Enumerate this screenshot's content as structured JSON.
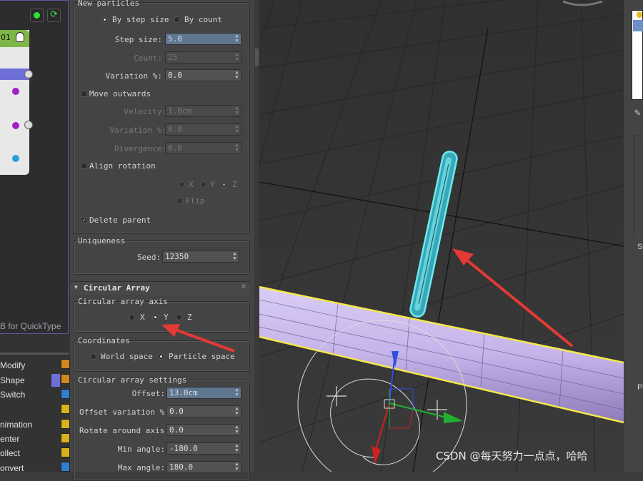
{
  "node_editor": {
    "node_title": "01",
    "quicktype_hint": "B for QuickType",
    "operators": [
      "Modify",
      "Shape",
      "Switch",
      "nimation",
      "enter",
      "ollect",
      "onvert"
    ]
  },
  "new_particles": {
    "title": "New particles",
    "by_step_size": "By step size",
    "by_count": "By count",
    "step_size_label": "Step size:",
    "step_size_value": "5.0",
    "count_label": "Count:",
    "count_value": "25",
    "variation_label": "Variation %:",
    "variation_value": "0.0",
    "move_outwards": "Move outwards",
    "velocity_label": "Velocity:",
    "velocity_value": "1.0cm",
    "variation2_label": "Variation %:",
    "variation2_value": "0.0",
    "divergence_label": "Divergence:",
    "divergence_value": "0.0",
    "align_rotation": "Align rotation",
    "axis_x": "X",
    "axis_y": "Y",
    "axis_z": "Z",
    "flip": "Flip",
    "delete_parent": "Delete parent"
  },
  "uniqueness": {
    "title": "Uniqueness",
    "seed_label": "Seed:",
    "seed_value": "12350"
  },
  "circular_array": {
    "rollout_title": "Circular Array",
    "axis_group": "Circular array axis",
    "axis_x": "X",
    "axis_y": "Y",
    "axis_z": "Z",
    "selected_axis": "Y",
    "coords_group": "Coordinates",
    "world_space": "World space",
    "particle_space": "Particle space",
    "settings_group": "Circular array settings",
    "offset_label": "Offset:",
    "offset_value": "13.0cm",
    "offset_var_label": "Offset variation %:",
    "offset_var_value": "0.0",
    "rotate_label": "Rotate around axis:",
    "rotate_value": "0.0",
    "min_angle_label": "Min angle:",
    "min_angle_value": "-180.0",
    "max_angle_label": "Max angle:",
    "max_angle_value": "180.0"
  },
  "right_strip": {
    "label_s": "S",
    "label_p": "P"
  },
  "watermark": "CSDN @每天努力一点点，哈哈",
  "colors": {
    "node_header": "#7fb648",
    "selection": "#6f6fd8",
    "cylinder": "#c9b8ec",
    "selection_outline": "#f4e94c",
    "particle": "#6fe8ef",
    "arrow": "#e53935"
  }
}
